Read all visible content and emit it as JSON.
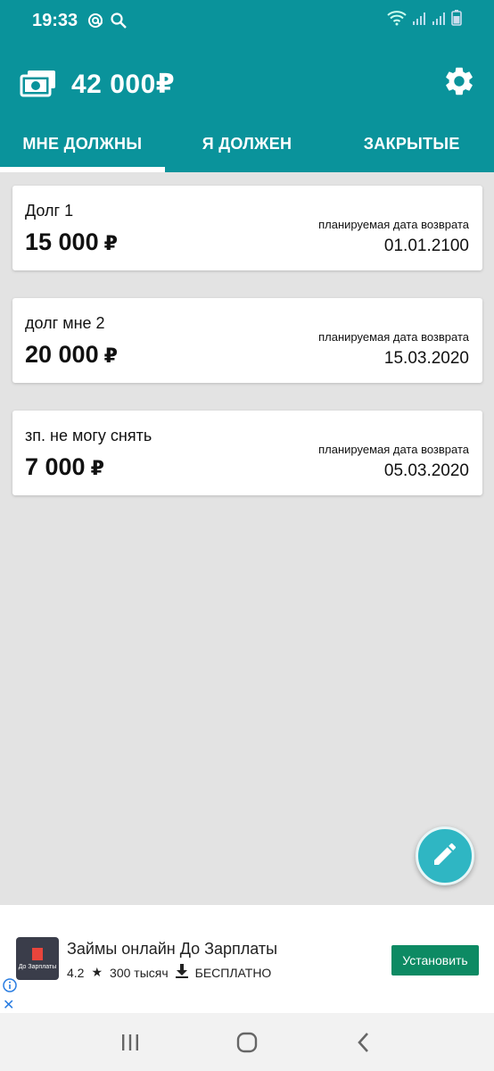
{
  "status_bar": {
    "time": "19:33"
  },
  "header": {
    "balance": "42 000₽",
    "tabs": [
      {
        "label": "МНЕ ДОЛЖНЫ",
        "active": true
      },
      {
        "label": "Я ДОЛЖЕН",
        "active": false
      },
      {
        "label": "ЗАКРЫТЫЕ",
        "active": false
      }
    ]
  },
  "debts": [
    {
      "title": "Долг 1",
      "amount": "15 000",
      "currency": "₽",
      "date_caption": "планируемая дата возврата",
      "date": "01.01.2100"
    },
    {
      "title": "долг мне 2",
      "amount": "20 000",
      "currency": "₽",
      "date_caption": "планируемая дата возврата",
      "date": "15.03.2020"
    },
    {
      "title": "зп. не могу снять",
      "amount": "7 000",
      "currency": "₽",
      "date_caption": "планируемая дата возврата",
      "date": "05.03.2020"
    }
  ],
  "ad": {
    "logo_text": "До Зарплаты",
    "title": "Займы онлайн До Зарплаты",
    "rating": "4.2",
    "downloads": "300 тысяч",
    "price": "БЕСПЛАТНО",
    "install_label": "Установить"
  },
  "colors": {
    "primary": "#0a939b",
    "fab": "#2fb6c3",
    "install": "#0d8a63",
    "background": "#e3e3e3"
  }
}
